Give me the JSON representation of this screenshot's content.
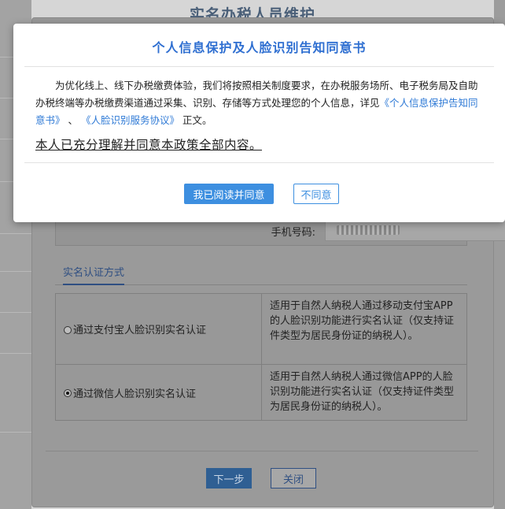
{
  "page": {
    "title": "实名办税人员维护"
  },
  "form": {
    "phone_label": "手机号码:",
    "auth_tab_label": "实名认证方式",
    "options": [
      {
        "label": "通过支付宝人脸识别实名认证",
        "description": "适用于自然人纳税人通过移动支付宝APP的人脸识别功能进行实名认证（仅支持证件类型为居民身份证的纳税人）。",
        "checked": false
      },
      {
        "label": "通过微信人脸识别实名认证",
        "description": "适用于自然人纳税人通过微信APP的人脸识别功能进行实名认证（仅支持证件类型为居民身份证的纳税人）。",
        "checked": true
      }
    ],
    "next_button": "下一步",
    "close_button": "关闭"
  },
  "modal": {
    "title": "个人信息保护及人脸识别告知同意书",
    "body_text": "为优化线上、线下办税缴费体验，我们将按照相关制度要求，在办税服务场所、电子税务局及自助办税终端等办税缴费渠道通过采集、识别、存储等方式处理您的个人信息，详见",
    "link_privacy": "《个人信息保护告知同意书》",
    "separator": "、",
    "link_face": "《人脸识别服务协议》",
    "body_suffix": "正文。",
    "consent_text": "本人已充分理解并同意本政策全部内容。",
    "agree_button": "我已阅读并同意",
    "disagree_button": "不同意"
  },
  "colors": {
    "accent": "#3d8fe0",
    "title_blue": "#2f6fd1",
    "link_blue": "#2f7ad6"
  }
}
